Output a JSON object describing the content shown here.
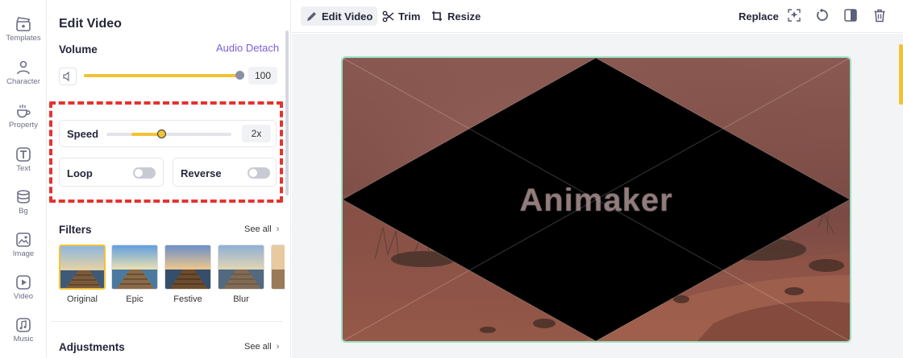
{
  "rail": {
    "items": [
      {
        "label": "Templates",
        "icon": "clapperboard-icon"
      },
      {
        "label": "Character",
        "icon": "person-icon"
      },
      {
        "label": "Property",
        "icon": "cup-icon"
      },
      {
        "label": "Text",
        "icon": "text-t-icon"
      },
      {
        "label": "Bg",
        "icon": "layers-icon"
      },
      {
        "label": "Image",
        "icon": "image-icon"
      },
      {
        "label": "Video",
        "icon": "play-icon"
      },
      {
        "label": "Music",
        "icon": "music-note-icon"
      }
    ]
  },
  "panel": {
    "title": "Edit Video",
    "volume": {
      "label": "Volume",
      "detach_link": "Audio Detach",
      "value": "100",
      "level": 1.0
    },
    "speed": {
      "label": "Speed",
      "value": "2x",
      "level": 0.44
    },
    "loop": {
      "label": "Loop",
      "on": false
    },
    "reverse": {
      "label": "Reverse",
      "on": false
    },
    "filters": {
      "title": "Filters",
      "see_all": "See all",
      "items": [
        {
          "label": "Original",
          "selected": true
        },
        {
          "label": "Epic",
          "selected": false
        },
        {
          "label": "Festive",
          "selected": false
        },
        {
          "label": "Blur",
          "selected": false
        }
      ]
    },
    "adjustments": {
      "title": "Adjustments",
      "see_all": "See all"
    }
  },
  "toolbar": {
    "edit_video": "Edit Video",
    "trim": "Trim",
    "resize": "Resize",
    "replace": "Replace"
  },
  "canvas": {
    "watermark": "Animaker"
  },
  "colors": {
    "accent": "#f2c235",
    "highlight": "#e3342f",
    "link": "#7b5fd9",
    "frame": "#9ae0c4"
  }
}
